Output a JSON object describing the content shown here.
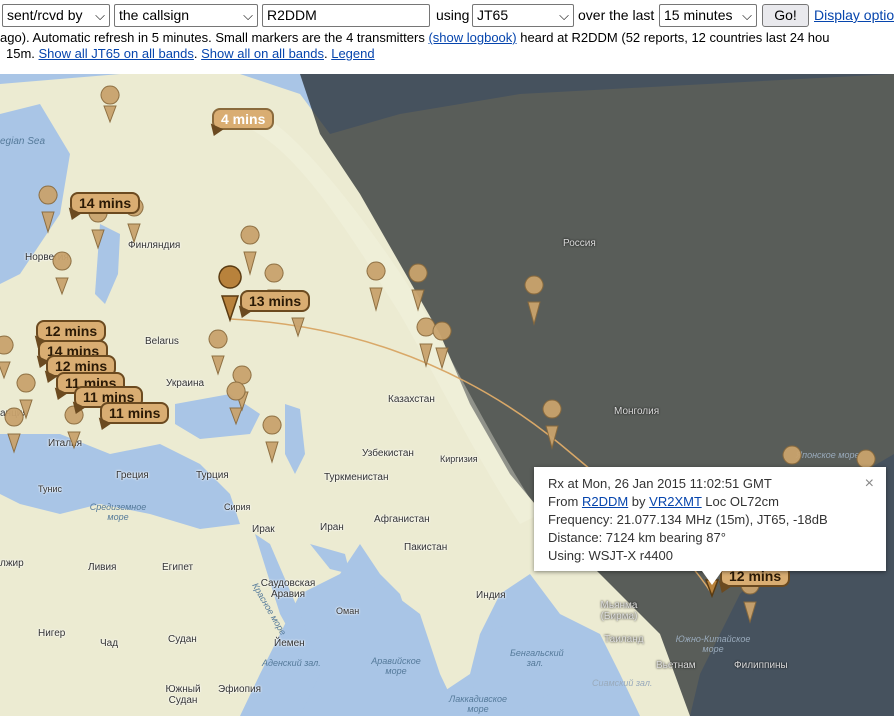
{
  "controls": {
    "mode_select": "sent/rcvd by",
    "target_select": "the callsign",
    "callsign_input": "R2DDM",
    "using_label": "using",
    "mode2_select": "JT65",
    "over_label": "over the last",
    "period_select": "15 minutes",
    "go_button": "Go!",
    "display_link": "Display optio"
  },
  "status": {
    "line2_prefix": "ago). Automatic refresh in 5 minutes. Small markers are the 4 transmitters ",
    "show_logbook": "(show logbook)",
    "line2_suffix": " heard at R2DDM (52 reports, 12 countries last 24 hou",
    "line3_prefix": "15m. ",
    "show_jt65": "Show all JT65 on all bands",
    "sep1": ". ",
    "show_all": "Show all on all bands",
    "sep2": ". ",
    "legend": "Legend"
  },
  "map_labels": {
    "norwegian_sea": "egian Sea",
    "norway": "Норвегия",
    "finland": "Финляндия",
    "russia": "Россия",
    "belarus": "Belarus",
    "ukraine": "Украина",
    "kazakhstan": "Казахстан",
    "mongolia": "Монголия",
    "uzbekistan": "Узбекистан",
    "kyrgyzstan": "Киргизия",
    "turkmenistan": "Туркменистан",
    "france": "анция",
    "italy": "Италия",
    "greece": "Греция",
    "turkey": "Турция",
    "syria": "Сирия",
    "iraq": "Ирак",
    "iran": "Иран",
    "afghanistan": "Афганистан",
    "pakistan": "Пакистан",
    "tunisia": "Тунис",
    "med_sea": "Средиземное море",
    "algeria": "лжир",
    "libya": "Ливия",
    "egypt": "Египет",
    "saudi": "Саудовская Аравия",
    "oman": "Оман",
    "india": "Индия",
    "niger": "Нигер",
    "chad": "Чад",
    "sudan": "Судан",
    "yemen": "Йемен",
    "red_sea": "Красное море",
    "arabian_sea": "Аравийское море",
    "bengal": "Бенгальский зал.",
    "aden": "Аденский зал.",
    "myanmar": "Мьянма (Бирма)",
    "thailand": "Таиланд",
    "vietnam": "Вьетнам",
    "philippines": "Филиппины",
    "scs": "Южно-Китайское море",
    "siam": "Сиамский зал.",
    "japan_sea": "Японское море",
    "ethiopia": "Эфиопия",
    "south_sudan": "Южный Судан",
    "laccadive": "Лаккадивское море"
  },
  "time_tags": [
    "4 mins",
    "14 mins",
    "13 mins",
    "12 mins",
    "14 mins",
    "12 mins",
    "11 mins",
    "11 mins",
    "11 mins",
    "12 mins"
  ],
  "info_window": {
    "rx": "Rx at Mon, 26 Jan 2015 11:02:51 GMT",
    "from_prefix": "From ",
    "from_call": "R2DDM",
    "by_prefix": " by ",
    "by_call": "VR2XMT",
    "loc": " Loc OL72cm",
    "frequency": "Frequency: 21.077.134 MHz (15m), JT65, -18dB",
    "distance": "Distance: 7124 km bearing 87°",
    "using": "Using: WSJT-X r4400",
    "close": "×"
  },
  "colors": {
    "marker": "#c9a36d",
    "tag_fill": "#d9ad72",
    "link": "#0645ad"
  }
}
